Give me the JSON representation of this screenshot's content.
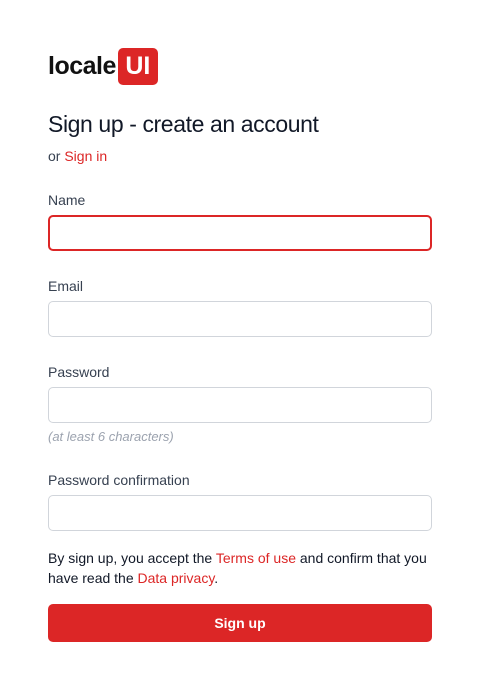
{
  "logo": {
    "text": "locale",
    "badge": "UI"
  },
  "heading": "Sign up - create an account",
  "signin": {
    "prefix": "or",
    "link": "Sign in"
  },
  "fields": {
    "name": {
      "label": "Name",
      "value": "",
      "focused": true
    },
    "email": {
      "label": "Email",
      "value": ""
    },
    "password": {
      "label": "Password",
      "value": "",
      "hint": "(at least 6 characters)"
    },
    "password_confirmation": {
      "label": "Password confirmation",
      "value": ""
    }
  },
  "terms": {
    "part1": "By sign up, you accept the ",
    "terms_link": "Terms of use",
    "part2": " and confirm that you have read the ",
    "privacy_link": "Data privacy",
    "part3": "."
  },
  "submit_label": "Sign up",
  "colors": {
    "accent": "#dc2626",
    "text": "#111827",
    "muted": "#9ca3af",
    "border": "#d1d5db"
  }
}
